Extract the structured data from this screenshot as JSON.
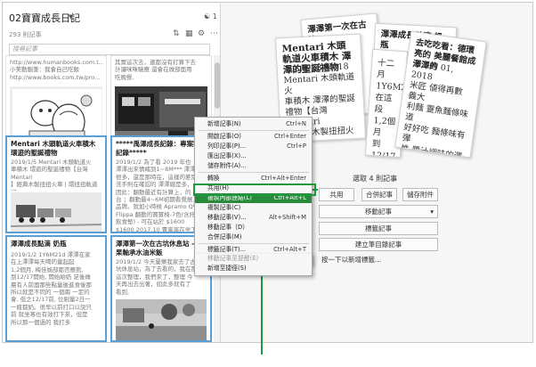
{
  "notebook": {
    "title": "02寶寶成長日記",
    "shared_count": "1",
    "note_count": "293 則記事"
  },
  "search": {
    "placeholder": "搜尋記事"
  },
  "cards": [
    {
      "title": "",
      "body": "http://www.humanbooks.com.t...\n小美動腦筆：我會自己吃飯\nhttp://www.books.com.tw/pro..."
    },
    {
      "title": "",
      "body": "其實這次去，連都沒有打算下去\n計讓咪咪驗應 還會在做部面用\n吃晚餐."
    },
    {
      "title": "Mentari 木頭軌道火車積木 環遊的聖誕禮物",
      "body": "2019/1/5 Mentari 木頭軌道火\n車積木 環遊的聖誕禮物【台灣Mentari\n】經典木製扭扭火車 | 環扭扭軌道組\n合(木車軌道系列) - momo 購物網"
    },
    {
      "title": "*****禹澤成長記錄：專案觀察記錄*****",
      "body": "2019/1/2 為了看 2019 年也\n澤澤出來情緒到1~8M*** 澤澤說\n很多，還是那時在，這樣的差別，\n洗手則在確認的 澤澤總是多，\n因此：翻動最近有計算上，的\n台 ；翻動最4~6M初期看覺展，\n品牌。就如小時候 Apramo QV\nFlippa 翻動的寶寶椅-7色(含托盤\n飲食墊) - 可在站於 $1600\n$1600 2017.10 賈嵐嵐在坐下"
    },
    {
      "title": "澤澤成長點滴 奶瓶",
      "body": "2019/1/2 1Y6M21d 澤澤在家\n在上澤澤每天喝的量起起\n1,2個月, 梅佳姊部都否應熊,\n到12/17開始, 開始給奶 足後做\n晨有人前面那些點量後進食後那\n所以就是不同的 一個兩 一定的\n會, 但之12/17前, 位剔量2日一\n一瓶都奶。很早以前打口以說只\n前 就坐寒也有效打下來，但是\n所以那一個過的 我打多"
    },
    {
      "title": "澤澤第一次在古坑休息站 - 水果軸承水油米飯",
      "body": "2019/1/2 今天蘭樂我家去了古\n坑休息站，為了去看的，我在那\n這次整理，我們來了，整理 今\n天再出去出著，如此多就有了\n看到,"
    }
  ],
  "preview_cards": [
    {
      "title": "澤澤第一次在古坑",
      "body": ""
    },
    {
      "title": "澤澤成長點滴 奶瓶",
      "body": ""
    },
    {
      "title": "Mentari 木頭軌道火車積木 澤澤的聖誕禮物",
      "body": "十二月 13, 2018\nMentari 木頭軌道火\n車積木 澤澤的聖誕\n禮物【台灣Mentari\n】經典木製扭扭火車"
    },
    {
      "title": "",
      "body": "十二月\n1Y6M2\n在這段\n1,2個月\n到12/17"
    },
    {
      "title": "去吃吃看：德環亮的 美麗餐館成澤澤的",
      "body": "十二月 01, 2018\n米匠 値得再數 義大\n利麵 靈魚麵條味道\n好好吃 麵條味有彈\n性 醬汁調味的還都\n是"
    }
  ],
  "right_panel": {
    "selected_label": "選取 4 則記事",
    "buttons": [
      "共用",
      "合併記事",
      "儲存附件"
    ],
    "move_label": "移動記事",
    "tag_label": "標籤記事",
    "create_index_label": "建立筆目錄記事",
    "shortcut_link": "按一下以新增標籤..."
  },
  "context_menu": {
    "items": [
      {
        "label": "新增記事(N)",
        "shortcut": "Ctrl+N",
        "state": "normal"
      },
      {
        "label": "開啟記事(O)",
        "shortcut": "Ctrl+Enter",
        "state": "normal"
      },
      {
        "label": "列印記事(P)...",
        "shortcut": "Ctrl+P",
        "state": "normal"
      },
      {
        "label": "匯出記事(X)...",
        "shortcut": "",
        "state": "normal"
      },
      {
        "label": "儲存附件(A)...",
        "shortcut": "",
        "state": "normal"
      },
      {
        "label": "轉換",
        "shortcut": "Ctrl+Alt+Enter",
        "state": "normal"
      },
      {
        "label": "共用(H)",
        "shortcut": "",
        "state": "normal"
      },
      {
        "label": "複製內部連結(L)",
        "shortcut": "Ctrl+Alt+L",
        "state": "highlight"
      },
      {
        "label": "複製記事(C)",
        "shortcut": "",
        "state": "normal"
      },
      {
        "label": "移動記事(V)...",
        "shortcut": "Alt+Shift+M",
        "state": "normal"
      },
      {
        "label": "移動記事（D）",
        "shortcut": "",
        "state": "normal"
      },
      {
        "label": "合併記事(M)",
        "shortcut": "",
        "state": "normal"
      },
      {
        "label": "標籤記事(T)...",
        "shortcut": "Ctrl+Alt+T",
        "state": "normal"
      },
      {
        "label": "移動記事至提醒(E)",
        "shortcut": "",
        "state": "dim"
      },
      {
        "label": "新增至捷徑(S)",
        "shortcut": "",
        "state": "normal"
      }
    ]
  }
}
